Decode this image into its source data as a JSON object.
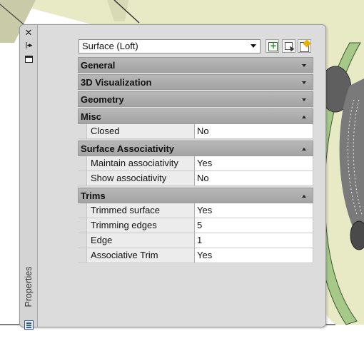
{
  "palette": {
    "title": "Properties",
    "object_type": "Surface (Loft)"
  },
  "categories": [
    {
      "label": "General",
      "state": "collapsed"
    },
    {
      "label": "3D Visualization",
      "state": "collapsed"
    },
    {
      "label": "Geometry",
      "state": "collapsed"
    },
    {
      "label": "Misc",
      "state": "expanded",
      "properties": [
        {
          "name": "Closed",
          "value": "No"
        }
      ]
    },
    {
      "label": "Surface Associativity",
      "state": "expanded",
      "properties": [
        {
          "name": "Maintain associativity",
          "value": "Yes"
        },
        {
          "name": "Show associativity",
          "value": "No"
        }
      ]
    },
    {
      "label": "Trims",
      "state": "expanded",
      "properties": [
        {
          "name": "Trimmed surface",
          "value": "Yes"
        },
        {
          "name": "Trimming edges",
          "value": "5"
        },
        {
          "name": "Edge",
          "value": "1"
        },
        {
          "name": "Associative Trim",
          "value": "Yes"
        }
      ]
    }
  ],
  "icons": {
    "close": "close-icon",
    "autohide": "auto-hide-icon",
    "menu": "properties-menu-icon",
    "pickadd": "pickadd-toggle-icon",
    "select": "select-objects-icon",
    "quick_select": "quick-select-icon"
  },
  "colors": {
    "background_fill": "#e7e9c4",
    "surface_green": "#a6c98a",
    "object_grey": "#6f6f6f",
    "palette_bg": "#dcdcdc",
    "category_header": "#ababab"
  }
}
